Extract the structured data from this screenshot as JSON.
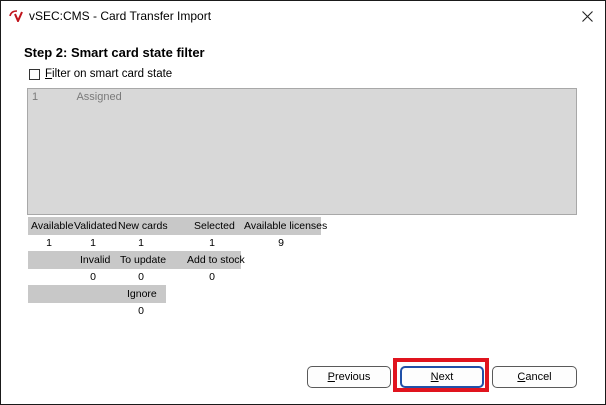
{
  "window": {
    "title": "vSEC:CMS - Card Transfer Import"
  },
  "step": {
    "title": "Step 2: Smart card state filter"
  },
  "filter": {
    "label_first": "F",
    "label_rest": "ilter on smart card state",
    "checked": false
  },
  "state_list": {
    "items": [
      {
        "num": "1",
        "label": "Assigned"
      }
    ]
  },
  "stats": {
    "row1": {
      "headers": [
        "Available",
        "Validated",
        "New cards",
        "Selected",
        "Available licenses"
      ],
      "values": [
        "1",
        "1",
        "1",
        "1",
        "9"
      ]
    },
    "row2": {
      "headers": [
        "Invalid",
        "To update",
        "Add to stock"
      ],
      "values": [
        "0",
        "0",
        "0"
      ]
    },
    "row3": {
      "headers": [
        "Ignore"
      ],
      "values": [
        "0"
      ]
    }
  },
  "buttons": {
    "previous": {
      "first": "P",
      "rest": "revious"
    },
    "next": {
      "first": "N",
      "rest": "ext"
    },
    "cancel": {
      "first": "C",
      "rest": "ancel"
    }
  },
  "colors": {
    "highlight": "#e0141e",
    "list_bg": "#d8d8d8",
    "header_bg": "#c8c8c8",
    "logo": "#c0141c"
  },
  "icons": {
    "close": "close-icon",
    "logo": "app-logo-icon"
  }
}
